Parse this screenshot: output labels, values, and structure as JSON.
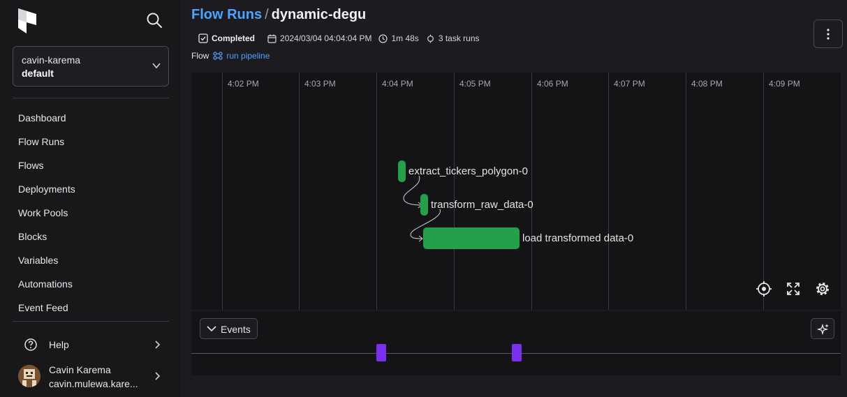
{
  "sidebar": {
    "workspace": {
      "account": "cavin-karema",
      "name": "default"
    },
    "nav_items": [
      {
        "label": "Dashboard"
      },
      {
        "label": "Flow Runs"
      },
      {
        "label": "Flows"
      },
      {
        "label": "Deployments"
      },
      {
        "label": "Work Pools"
      },
      {
        "label": "Blocks"
      },
      {
        "label": "Variables"
      },
      {
        "label": "Automations"
      },
      {
        "label": "Event Feed"
      }
    ],
    "help_label": "Help",
    "user": {
      "name": "Cavin Karema",
      "email": "cavin.mulewa.kare..."
    }
  },
  "header": {
    "breadcrumb_parent": "Flow Runs",
    "separator": "/",
    "run_name": "dynamic-degu",
    "state": "Completed",
    "start_time": "2024/03/04 04:04:04 PM",
    "duration": "1m 48s",
    "task_runs": "3 task runs",
    "flow_label": "Flow",
    "flow_name": "run pipeline"
  },
  "timeline": {
    "ticks": [
      "4:02 PM",
      "4:03 PM",
      "4:04 PM",
      "4:05 PM",
      "4:06 PM",
      "4:07 PM",
      "4:08 PM",
      "4:09 PM"
    ],
    "task_runs": [
      {
        "name": "extract_tickers_polygon-0"
      },
      {
        "name": "transform_raw_data-0"
      },
      {
        "name": "load transformed data-0"
      }
    ]
  },
  "events": {
    "button_label": "Events",
    "marker_count": 2
  },
  "colors": {
    "accent": "#4da3ff",
    "completed": "#22a04a",
    "event": "#7b2ff0",
    "background": "#1c1c20"
  },
  "icons": [
    "prefect-logo",
    "search-icon",
    "chevron-down-icon",
    "help-icon",
    "chevron-right-icon",
    "avatar",
    "kebab-icon",
    "check-square-icon",
    "calendar-icon",
    "clock-icon",
    "task-run-icon",
    "flow-icon",
    "target-icon",
    "expand-icon",
    "gear-icon",
    "sparkles-icon"
  ]
}
